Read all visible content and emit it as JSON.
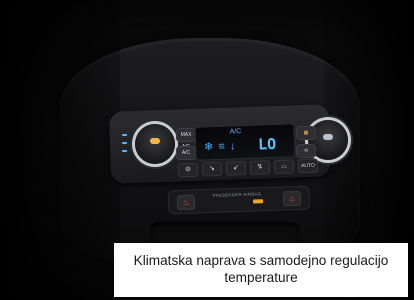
{
  "caption": {
    "line1": "Klimatska naprava s samodejno regulacijo",
    "line2": "temperature"
  },
  "display": {
    "ac_label": "A/C",
    "temperature": "LO",
    "icons": "❄ ≡ ↓"
  },
  "buttons": {
    "max_ac": "MAX A/C",
    "ac": "A/C",
    "recirc": "⟲",
    "auto": "AUTO",
    "passenger_airbag": "PASSENGER AIRBAG"
  },
  "colors": {
    "display_glow": "#5cc0ff",
    "knob_marker_left": "#f2b84a",
    "seat_heat": "#e8452c",
    "airbag_led": "#e9a72a"
  }
}
